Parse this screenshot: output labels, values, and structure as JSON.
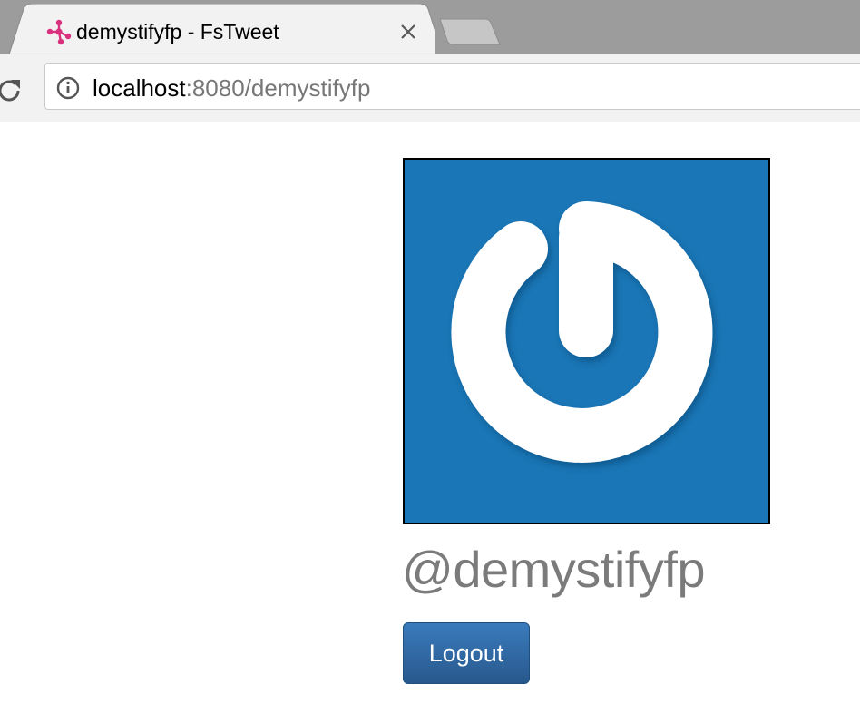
{
  "browser": {
    "tab": {
      "title": "demystifyfp - FsTweet",
      "favicon": "fstweet-favicon-icon",
      "close": "close-icon"
    },
    "address_bar": {
      "host": "localhost",
      "rest": ":8080/demystifyfp",
      "info_icon": "info-icon",
      "reload_icon": "reload-icon"
    }
  },
  "profile": {
    "avatar": "gravatar-power-icon",
    "username": "@demystifyfp",
    "logout_label": "Logout"
  },
  "colors": {
    "tab_strip": "#9c9c9c",
    "tab_active": "#f2f2f2",
    "avatar_background": "#1a76b6",
    "username_text": "#7b7b7b",
    "button_primary": "#2f67a3",
    "favicon": "#d8327f"
  }
}
